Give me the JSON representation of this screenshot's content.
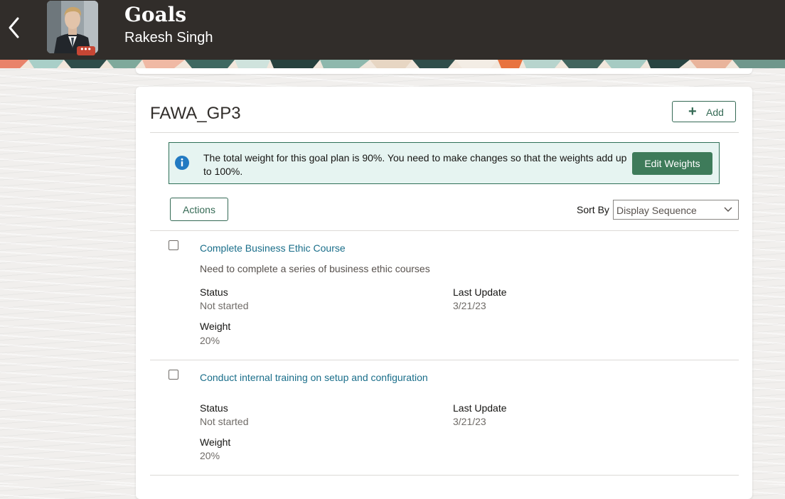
{
  "header": {
    "title": "Goals",
    "person_name": "Rakesh Singh",
    "back_icon": "chevron-left-icon",
    "avatar_badge": "•••",
    "background_color": "#312d2a"
  },
  "plan": {
    "name": "FAWA_GP3",
    "add_label": "Add",
    "add_icon": "plus-icon"
  },
  "alert": {
    "icon": "info-icon",
    "message": "The total weight for this goal plan is 90%. You need to make changes so that the weights add up to 100%.",
    "edit_weights_label": "Edit Weights"
  },
  "toolbar": {
    "actions_label": "Actions",
    "sort_label": "Sort By",
    "sort_value": "Display Sequence"
  },
  "goals": [
    {
      "title": "Complete Business Ethic Course",
      "description": "Need to complete a series of business ethic courses",
      "status_label": "Status",
      "status_value": "Not started",
      "last_update_label": "Last Update",
      "last_update_value": "3/21/23",
      "weight_label": "Weight",
      "weight_value": "20%"
    },
    {
      "title": "Conduct internal training on setup and configuration",
      "description": "",
      "status_label": "Status",
      "status_value": "Not started",
      "last_update_label": "Last Update",
      "last_update_value": "3/21/23",
      "weight_label": "Weight",
      "weight_value": "20%"
    }
  ],
  "colors": {
    "accent_green": "#356a55",
    "button_green": "#3e7b5a",
    "link_blue": "#1a6e8a",
    "alert_background": "#e6f4f1",
    "info_blue": "#227ac2"
  }
}
